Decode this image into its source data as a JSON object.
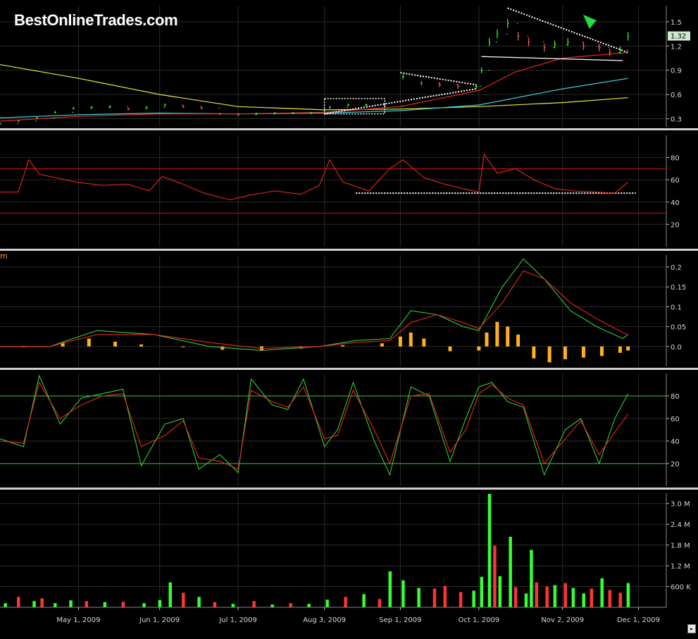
{
  "header": {
    "logo_text": "BestOnlineTrades.com"
  },
  "colors": {
    "background": "#000000",
    "grid": "#2b2b2b",
    "divider": "#cfcfcf",
    "up_bar": "#33ff33",
    "down_bar": "#ff3333",
    "price_bar_down": "#ff6666",
    "ma_fast": "#e8281e",
    "ma_mid": "#3ad0e0",
    "ma_slow": "#e8e83a",
    "rsi_line": "#e8281e",
    "macd_line": "#33cc33",
    "signal_line": "#e8281e",
    "histogram": "#ffb020",
    "stoch_k": "#33cc33",
    "stoch_d": "#e8281e",
    "level_line_rsi": "#cc1111",
    "level_line_stoch": "#33cc33",
    "trendline": "#ffffff",
    "arrow": "#22dd44",
    "last_price_badge": "#cfe7cf"
  },
  "panels": {
    "macd_label": "m",
    "scroll_glyph": "▸"
  },
  "chart_data": [
    {
      "type": "line",
      "panel": "price",
      "title": "",
      "y_scale": "linear",
      "ylim": [
        0.2,
        1.7
      ],
      "y_ticks": [
        "0.3",
        "0.6",
        "0.9",
        "1.2",
        "1.5"
      ],
      "y_tick_values": [
        0.3,
        0.6,
        0.9,
        1.2,
        1.5
      ],
      "last_price_label": "1.32",
      "last_price": 1.32,
      "price_series": {
        "name": "",
        "x": [
          "2009-04-01",
          "2009-04-08",
          "2009-04-15",
          "2009-04-22",
          "2009-04-29",
          "2009-05-06",
          "2009-05-13",
          "2009-05-20",
          "2009-05-27",
          "2009-06-03",
          "2009-06-10",
          "2009-06-17",
          "2009-06-24",
          "2009-07-01",
          "2009-07-08",
          "2009-07-15",
          "2009-07-22",
          "2009-07-29",
          "2009-08-05",
          "2009-08-12",
          "2009-08-19",
          "2009-08-26",
          "2009-09-02",
          "2009-09-09",
          "2009-09-16",
          "2009-09-23",
          "2009-09-30",
          "2009-10-02",
          "2009-10-05",
          "2009-10-08",
          "2009-10-12",
          "2009-10-16",
          "2009-10-20",
          "2009-10-26",
          "2009-10-30",
          "2009-11-04",
          "2009-11-10",
          "2009-11-16",
          "2009-11-20",
          "2009-11-24",
          "2009-11-27"
        ],
        "values": [
          0.24,
          0.27,
          0.31,
          0.38,
          0.43,
          0.44,
          0.45,
          0.42,
          0.44,
          0.47,
          0.45,
          0.43,
          0.36,
          0.35,
          0.36,
          0.37,
          0.37,
          0.37,
          0.44,
          0.47,
          0.47,
          0.46,
          0.82,
          0.74,
          0.72,
          0.7,
          0.7,
          0.9,
          1.25,
          1.35,
          1.48,
          1.32,
          1.25,
          1.18,
          1.22,
          1.25,
          1.2,
          1.18,
          1.12,
          1.15,
          1.32
        ]
      },
      "ma_series": [
        {
          "name": "",
          "color_key": "ma_slow",
          "x": [
            "2009-04-01",
            "2009-05-01",
            "2009-06-01",
            "2009-07-01",
            "2009-08-03",
            "2009-09-01",
            "2009-10-01",
            "2009-11-02",
            "2009-11-27"
          ],
          "values": [
            0.97,
            0.8,
            0.6,
            0.45,
            0.41,
            0.42,
            0.45,
            0.5,
            0.56
          ]
        },
        {
          "name": "",
          "color_key": "ma_mid",
          "x": [
            "2009-04-01",
            "2009-05-01",
            "2009-06-01",
            "2009-07-01",
            "2009-08-03",
            "2009-09-01",
            "2009-10-01",
            "2009-11-02",
            "2009-11-27"
          ],
          "values": [
            0.31,
            0.35,
            0.37,
            0.36,
            0.37,
            0.4,
            0.47,
            0.67,
            0.8
          ]
        },
        {
          "name": "",
          "color_key": "ma_fast",
          "x": [
            "2009-04-01",
            "2009-05-01",
            "2009-06-01",
            "2009-07-01",
            "2009-08-03",
            "2009-09-01",
            "2009-10-01",
            "2009-10-15",
            "2009-11-02",
            "2009-11-27"
          ],
          "values": [
            0.27,
            0.33,
            0.36,
            0.36,
            0.38,
            0.45,
            0.65,
            0.88,
            1.05,
            1.12
          ]
        }
      ],
      "annotations": [
        {
          "kind": "dotted-box",
          "x": [
            "2009-08-03",
            "2009-08-26"
          ],
          "y": [
            0.36,
            0.55
          ]
        },
        {
          "kind": "dotted-triangle-top",
          "x": [
            "2009-09-01",
            "2009-09-30"
          ],
          "y": [
            0.87,
            0.72
          ]
        },
        {
          "kind": "dotted-triangle-bottom",
          "x": [
            "2009-08-03",
            "2009-09-30"
          ],
          "y": [
            0.36,
            0.67
          ]
        },
        {
          "kind": "dotted-trend",
          "x": [
            "2009-10-12",
            "2009-11-27"
          ],
          "y": [
            1.67,
            1.12
          ]
        },
        {
          "kind": "solid-trend",
          "x": [
            "2009-10-02",
            "2009-11-25"
          ],
          "y": [
            1.07,
            1.02
          ]
        },
        {
          "kind": "arrow-down",
          "x": "2009-11-12",
          "y": 1.5
        }
      ]
    },
    {
      "type": "line",
      "panel": "rsi",
      "title": "",
      "ylim": [
        0,
        100
      ],
      "y_ticks": [
        "20",
        "40",
        "60",
        "80"
      ],
      "y_tick_values": [
        20,
        40,
        60,
        80
      ],
      "levels": [
        30,
        70
      ],
      "support_line": {
        "x": [
          "2009-08-15",
          "2009-11-30"
        ],
        "value": 48
      },
      "series": [
        {
          "name": "",
          "x": [
            "2009-04-01",
            "2009-04-08",
            "2009-04-12",
            "2009-04-16",
            "2009-04-22",
            "2009-04-30",
            "2009-05-10",
            "2009-05-20",
            "2009-05-28",
            "2009-06-02",
            "2009-06-10",
            "2009-06-18",
            "2009-06-28",
            "2009-07-05",
            "2009-07-15",
            "2009-07-25",
            "2009-08-01",
            "2009-08-05",
            "2009-08-10",
            "2009-08-20",
            "2009-08-28",
            "2009-09-02",
            "2009-09-10",
            "2009-09-18",
            "2009-09-25",
            "2009-10-01",
            "2009-10-03",
            "2009-10-08",
            "2009-10-15",
            "2009-10-22",
            "2009-10-30",
            "2009-11-06",
            "2009-11-15",
            "2009-11-22",
            "2009-11-27"
          ],
          "values": [
            49,
            49,
            78,
            65,
            62,
            58,
            55,
            56,
            50,
            63,
            56,
            48,
            42,
            46,
            50,
            47,
            55,
            78,
            58,
            50,
            70,
            78,
            62,
            56,
            52,
            49,
            83,
            66,
            70,
            60,
            52,
            50,
            49,
            48,
            58
          ]
        }
      ]
    },
    {
      "type": "line",
      "panel": "macd",
      "title": "",
      "ylim": [
        -0.05,
        0.23
      ],
      "y_ticks": [
        "0.0",
        "0.05",
        "0.1",
        "0.15",
        "0.2"
      ],
      "y_tick_values": [
        0.0,
        0.05,
        0.1,
        0.15,
        0.2
      ],
      "series": [
        {
          "name": "",
          "color_key": "macd_line",
          "x": [
            "2009-04-01",
            "2009-04-20",
            "2009-05-08",
            "2009-05-30",
            "2009-06-20",
            "2009-07-10",
            "2009-08-01",
            "2009-08-15",
            "2009-08-28",
            "2009-09-05",
            "2009-09-15",
            "2009-09-25",
            "2009-10-01",
            "2009-10-10",
            "2009-10-18",
            "2009-10-26",
            "2009-11-05",
            "2009-11-15",
            "2009-11-25",
            "2009-11-27"
          ],
          "values": [
            0.0,
            0.0,
            0.04,
            0.03,
            0.0,
            -0.01,
            0.0,
            0.015,
            0.02,
            0.09,
            0.08,
            0.05,
            0.04,
            0.15,
            0.22,
            0.17,
            0.09,
            0.05,
            0.02,
            0.03
          ]
        },
        {
          "name": "",
          "color_key": "signal_line",
          "x": [
            "2009-04-01",
            "2009-04-20",
            "2009-05-08",
            "2009-05-30",
            "2009-06-20",
            "2009-07-10",
            "2009-08-01",
            "2009-08-15",
            "2009-08-28",
            "2009-09-05",
            "2009-09-15",
            "2009-09-25",
            "2009-10-01",
            "2009-10-10",
            "2009-10-18",
            "2009-10-26",
            "2009-11-05",
            "2009-11-15",
            "2009-11-25",
            "2009-11-27"
          ],
          "values": [
            0.0,
            0.0,
            0.03,
            0.03,
            0.01,
            -0.005,
            0.0,
            0.01,
            0.015,
            0.06,
            0.08,
            0.06,
            0.045,
            0.11,
            0.19,
            0.17,
            0.11,
            0.07,
            0.035,
            0.03
          ]
        }
      ],
      "histogram": {
        "name": "",
        "x": [
          "2009-04-10",
          "2009-04-25",
          "2009-05-05",
          "2009-05-15",
          "2009-05-25",
          "2009-06-10",
          "2009-06-25",
          "2009-07-10",
          "2009-07-25",
          "2009-08-10",
          "2009-08-25",
          "2009-09-01",
          "2009-09-05",
          "2009-09-10",
          "2009-09-20",
          "2009-10-01",
          "2009-10-04",
          "2009-10-08",
          "2009-10-12",
          "2009-10-16",
          "2009-10-22",
          "2009-10-28",
          "2009-11-03",
          "2009-11-10",
          "2009-11-17",
          "2009-11-24",
          "2009-11-27"
        ],
        "values": [
          0.0,
          0.01,
          0.02,
          0.012,
          0.005,
          0.0,
          -0.008,
          -0.01,
          -0.005,
          0.003,
          0.008,
          0.025,
          0.035,
          0.02,
          -0.012,
          -0.01,
          0.035,
          0.062,
          0.05,
          0.03,
          -0.03,
          -0.04,
          -0.032,
          -0.028,
          -0.024,
          -0.016,
          -0.01
        ]
      }
    },
    {
      "type": "line",
      "panel": "stochastic",
      "title": "",
      "ylim": [
        0,
        100
      ],
      "y_ticks": [
        "20",
        "40",
        "60",
        "80"
      ],
      "y_tick_values": [
        20,
        40,
        60,
        80
      ],
      "levels": [
        20,
        80
      ],
      "series": [
        {
          "name": "",
          "color_key": "stoch_k",
          "x": [
            "2009-04-01",
            "2009-04-10",
            "2009-04-16",
            "2009-04-24",
            "2009-05-02",
            "2009-05-10",
            "2009-05-18",
            "2009-05-25",
            "2009-06-03",
            "2009-06-10",
            "2009-06-16",
            "2009-06-24",
            "2009-07-01",
            "2009-07-06",
            "2009-07-14",
            "2009-07-20",
            "2009-07-26",
            "2009-08-03",
            "2009-08-08",
            "2009-08-14",
            "2009-08-22",
            "2009-08-28",
            "2009-09-05",
            "2009-09-12",
            "2009-09-20",
            "2009-09-26",
            "2009-10-01",
            "2009-10-06",
            "2009-10-12",
            "2009-10-18",
            "2009-10-26",
            "2009-11-03",
            "2009-11-09",
            "2009-11-16",
            "2009-11-22",
            "2009-11-27"
          ],
          "values": [
            42,
            35,
            98,
            55,
            78,
            82,
            86,
            18,
            55,
            60,
            15,
            28,
            12,
            95,
            72,
            68,
            95,
            35,
            50,
            92,
            40,
            10,
            88,
            80,
            22,
            60,
            88,
            92,
            75,
            70,
            10,
            50,
            60,
            20,
            60,
            82
          ]
        },
        {
          "name": "",
          "color_key": "stoch_d",
          "x": [
            "2009-04-01",
            "2009-04-10",
            "2009-04-16",
            "2009-04-24",
            "2009-05-02",
            "2009-05-10",
            "2009-05-18",
            "2009-05-25",
            "2009-06-03",
            "2009-06-10",
            "2009-06-16",
            "2009-06-24",
            "2009-07-01",
            "2009-07-06",
            "2009-07-14",
            "2009-07-20",
            "2009-07-26",
            "2009-08-03",
            "2009-08-08",
            "2009-08-14",
            "2009-08-22",
            "2009-08-28",
            "2009-09-05",
            "2009-09-12",
            "2009-09-20",
            "2009-09-26",
            "2009-10-01",
            "2009-10-06",
            "2009-10-12",
            "2009-10-18",
            "2009-10-26",
            "2009-11-03",
            "2009-11-09",
            "2009-11-16",
            "2009-11-22",
            "2009-11-27"
          ],
          "values": [
            40,
            38,
            92,
            60,
            72,
            80,
            82,
            35,
            45,
            58,
            25,
            22,
            15,
            85,
            75,
            70,
            88,
            42,
            45,
            85,
            50,
            20,
            80,
            82,
            30,
            50,
            82,
            90,
            78,
            72,
            20,
            42,
            58,
            28,
            48,
            64
          ]
        }
      ]
    },
    {
      "type": "bar",
      "panel": "volume",
      "title": "",
      "ylim": [
        0,
        3300000
      ],
      "y_ticks": [
        "600 K",
        "1.2 M",
        "1.8 M",
        "2.4 M",
        "3.0 M"
      ],
      "y_tick_values": [
        600000,
        1200000,
        1800000,
        2400000,
        3000000
      ],
      "x_ticks": [
        "May 1, 2009",
        "Jun 1, 2009",
        "Jul 1, 2009",
        "Aug 3, 2009",
        "Sep 1, 2009",
        "Oct 1, 2009",
        "Nov 2, 2009",
        "Dec 1, 2009"
      ],
      "x_tick_dates": [
        "2009-05-01",
        "2009-06-01",
        "2009-07-01",
        "2009-08-03",
        "2009-09-01",
        "2009-10-01",
        "2009-11-02",
        "2009-12-01"
      ],
      "x_range": [
        "2009-04-01",
        "2009-12-04"
      ],
      "series": [
        {
          "name": "",
          "x": [
            "2009-04-03",
            "2009-04-08",
            "2009-04-14",
            "2009-04-17",
            "2009-04-22",
            "2009-04-28",
            "2009-05-04",
            "2009-05-11",
            "2009-05-18",
            "2009-05-26",
            "2009-06-01",
            "2009-06-05",
            "2009-06-10",
            "2009-06-16",
            "2009-06-22",
            "2009-06-29",
            "2009-07-07",
            "2009-07-14",
            "2009-07-21",
            "2009-07-28",
            "2009-08-04",
            "2009-08-11",
            "2009-08-18",
            "2009-08-24",
            "2009-08-28",
            "2009-09-02",
            "2009-09-08",
            "2009-09-14",
            "2009-09-18",
            "2009-09-24",
            "2009-09-29",
            "2009-10-02",
            "2009-10-05",
            "2009-10-07",
            "2009-10-09",
            "2009-10-13",
            "2009-10-15",
            "2009-10-19",
            "2009-10-21",
            "2009-10-23",
            "2009-10-27",
            "2009-10-30",
            "2009-11-03",
            "2009-11-06",
            "2009-11-10",
            "2009-11-13",
            "2009-11-17",
            "2009-11-20",
            "2009-11-24",
            "2009-11-27"
          ],
          "values": [
            120000,
            300000,
            180000,
            260000,
            120000,
            200000,
            180000,
            150000,
            160000,
            120000,
            210000,
            720000,
            420000,
            300000,
            150000,
            100000,
            180000,
            80000,
            120000,
            100000,
            220000,
            300000,
            380000,
            240000,
            1040000,
            780000,
            560000,
            540000,
            620000,
            440000,
            480000,
            880000,
            3280000,
            1780000,
            900000,
            2040000,
            580000,
            400000,
            1660000,
            720000,
            600000,
            640000,
            700000,
            560000,
            400000,
            540000,
            840000,
            500000,
            420000,
            700000
          ],
          "directions": [
            "up",
            "down",
            "up",
            "down",
            "up",
            "up",
            "down",
            "up",
            "down",
            "up",
            "up",
            "up",
            "down",
            "up",
            "down",
            "up",
            "down",
            "up",
            "down",
            "up",
            "up",
            "down",
            "up",
            "down",
            "up",
            "up",
            "up",
            "down",
            "down",
            "down",
            "up",
            "up",
            "up",
            "down",
            "up",
            "up",
            "down",
            "up",
            "up",
            "down",
            "down",
            "up",
            "down",
            "up",
            "up",
            "down",
            "up",
            "down",
            "down",
            "up"
          ]
        }
      ]
    }
  ]
}
